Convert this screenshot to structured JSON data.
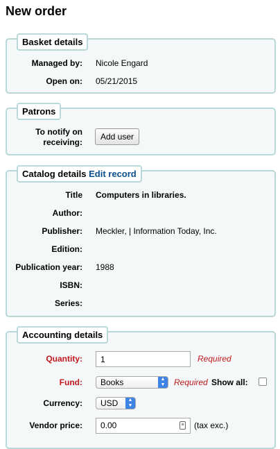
{
  "page_title": "New order",
  "basket": {
    "legend": "Basket details",
    "managed_by_label": "Managed by:",
    "managed_by_value": "Nicole Engard",
    "open_on_label": "Open on:",
    "open_on_value": "05/21/2015"
  },
  "patrons": {
    "legend": "Patrons",
    "notify_label_line1": "To notify on",
    "notify_label_line2": "receiving:",
    "add_user_button": "Add user"
  },
  "catalog": {
    "legend": "Catalog details",
    "edit_link": "Edit record",
    "fields": {
      "title_label": "Title",
      "title_value": "Computers in libraries.",
      "author_label": "Author:",
      "author_value": "",
      "publisher_label": "Publisher:",
      "publisher_value": "Meckler, | Information Today, Inc.",
      "edition_label": "Edition:",
      "edition_value": "",
      "pubyear_label": "Publication year:",
      "pubyear_value": "1988",
      "isbn_label": "ISBN:",
      "isbn_value": "",
      "series_label": "Series:",
      "series_value": ""
    }
  },
  "accounting": {
    "legend": "Accounting details",
    "quantity_label": "Quantity:",
    "quantity_value": "1",
    "quantity_required": "Required",
    "fund_label": "Fund:",
    "fund_value": "Books",
    "fund_required": "Required",
    "show_all_label": "Show all:",
    "currency_label": "Currency:",
    "currency_value": "USD",
    "vendor_price_label": "Vendor price:",
    "vendor_price_value": "0.00",
    "tax_note": "(tax exc.)"
  },
  "colors": {
    "required_red": "#c0181b",
    "link_blue": "#0a4e8c",
    "box_border": "#b9d8d9",
    "box_bg": "#f4f8f9"
  }
}
